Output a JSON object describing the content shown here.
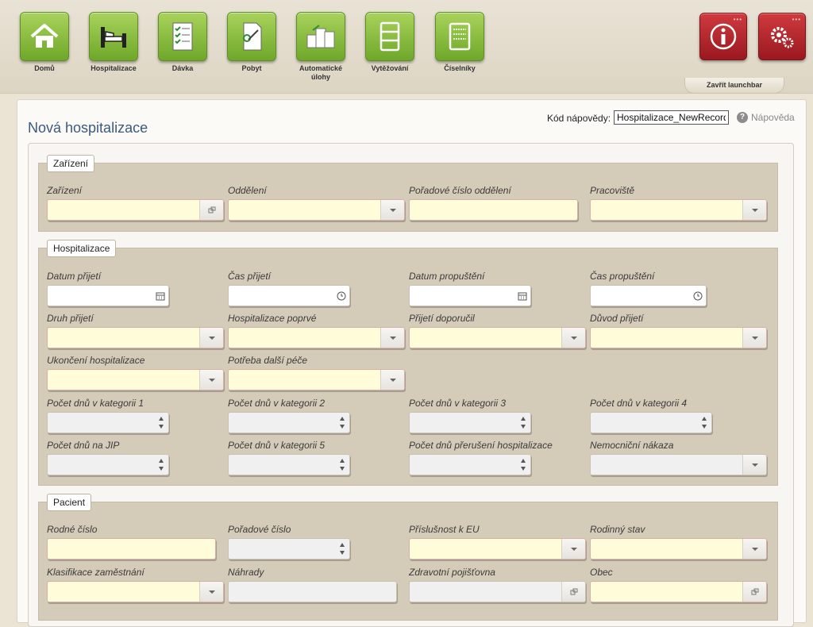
{
  "launchbar": {
    "items": [
      {
        "label": "Domů",
        "icon": "home-icon"
      },
      {
        "label": "Hospitalizace",
        "icon": "hospital-bed-icon"
      },
      {
        "label": "Dávka",
        "icon": "checklist-document-icon"
      },
      {
        "label": "Pobyt",
        "icon": "document-pen-icon"
      },
      {
        "label": "Automatické úlohy",
        "icon": "boxes-icon"
      },
      {
        "label": "Vytěžování",
        "icon": "cabinet-icon"
      },
      {
        "label": "Číselníky",
        "icon": "code-list-icon"
      }
    ],
    "info_icon": "info-icon",
    "settings_icon": "gears-icon",
    "close_label": "Zavřít launchbar"
  },
  "page": {
    "title": "Nová hospitalizace",
    "help_code_label": "Kód nápovědy:",
    "help_code_value": "Hospitalizace_NewRecord",
    "help_link": "Nápověda"
  },
  "sections": {
    "zarizeni": {
      "title": "Zařízení",
      "fields": {
        "zarizeni": "Zařízení",
        "oddeleni": "Oddělení",
        "poradove_cislo_oddeleni": "Pořadové číslo oddělení",
        "pracoviste": "Pracoviště"
      }
    },
    "hospitalizace": {
      "title": "Hospitalizace",
      "fields": {
        "datum_prijeti": "Datum přijetí",
        "cas_prijeti": "Čas přijetí",
        "datum_propusteni": "Datum propuštění",
        "cas_propusteni": "Čas propuštění",
        "druh_prijeti": "Druh přijetí",
        "hospitalizace_poprve": "Hospitalizace poprvé",
        "prijeti_doporucil": "Přijetí doporučil",
        "duvod_prijeti": "Důvod přijetí",
        "ukonceni_hospitalizace": "Ukončení hospitalizace",
        "potreba_dalsi_pece": "Potřeba další péče",
        "pocet_dnu_k1": "Počet dnů v kategorii 1",
        "pocet_dnu_k2": "Počet dnů v kategorii 2",
        "pocet_dnu_k3": "Počet dnů v kategorii 3",
        "pocet_dnu_k4": "Počet dnů v kategorii 4",
        "pocet_dnu_jip": "Počet dnů na JIP",
        "pocet_dnu_k5": "Počet dnů v kategorii 5",
        "pocet_dnu_preruseni": "Počet dnů přerušení hospitalizace",
        "nemocnicni_nakaza": "Nemocniční nákaza"
      }
    },
    "pacient": {
      "title": "Pacient",
      "fields": {
        "rodne_cislo": "Rodné číslo",
        "poradove_cislo": "Pořadové číslo",
        "prislusnost_eu": "Příslušnost k EU",
        "rodinny_stav": "Rodinný stav",
        "klasifikace_zamestnani": "Klasifikace zaměstnání",
        "nahrady": "Náhrady",
        "zdravotni_pojistovna": "Zdravotní pojišťovna",
        "obec": "Obec"
      }
    }
  }
}
